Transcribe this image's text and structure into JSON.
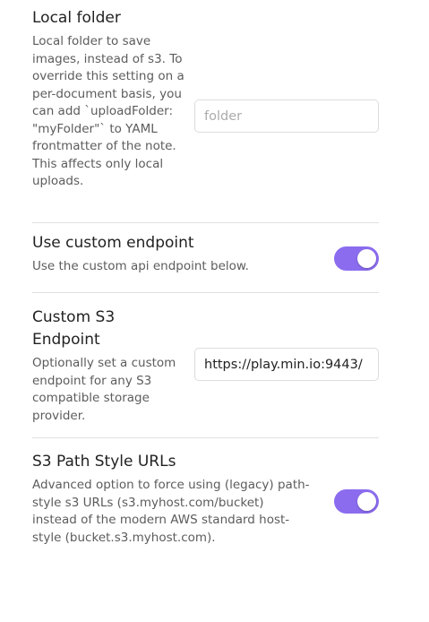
{
  "settings": {
    "local_folder": {
      "name": "Local folder",
      "description": "Local folder to save images, instead of s3. To override this setting on a per-document basis, you can add `uploadFolder: \"myFolder\"` to YAML frontmatter of the note. This affects only local uploads.",
      "input_placeholder": "folder",
      "input_value": ""
    },
    "custom_endpoint_toggle": {
      "name": "Use custom endpoint",
      "description": "Use the custom api endpoint below.",
      "enabled": true
    },
    "custom_s3_endpoint": {
      "name": "Custom S3 Endpoint",
      "description": "Optionally set a custom endpoint for any S3 compatible storage provider.",
      "input_value": "https://play.min.io:9443/"
    },
    "path_style_urls": {
      "name": "S3 Path Style URLs",
      "description": "Advanced option to force using (legacy) path-style s3 URLs (s3.myhost.com/bucket) instead of the modern AWS standard host-style (bucket.s3.myhost.com).",
      "enabled": true
    }
  },
  "colors": {
    "accent": "#8b6cef",
    "divider": "#e0e0e0",
    "description_text": "#5c5c5c"
  }
}
